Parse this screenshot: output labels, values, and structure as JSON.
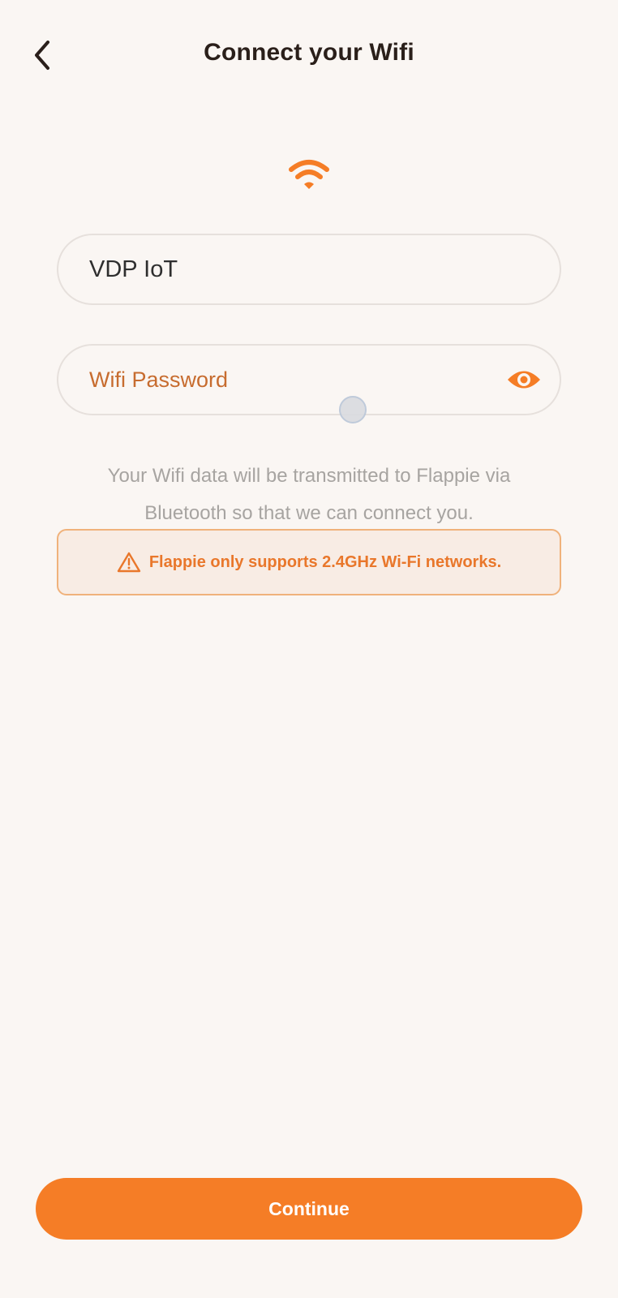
{
  "header": {
    "title": "Connect your Wifi",
    "back_icon": "chevron-left-icon"
  },
  "hero_icon": "wifi-icon",
  "form": {
    "ssid_value": "VDP IoT",
    "password_placeholder": "Wifi Password",
    "password_visibility_icon": "eye-icon"
  },
  "info": {
    "line1": "Your Wifi data will be transmitted to Flappie via",
    "line2": "Bluetooth so that we can connect you."
  },
  "warning": {
    "icon": "warning-triangle-icon",
    "text": "Flappie only supports 2.4GHz Wi-Fi networks."
  },
  "continue_label": "Continue",
  "colors": {
    "accent": "#f57d26",
    "background": "#faf6f3",
    "title": "#2a1f1a",
    "placeholder": "#c76c2f",
    "warning_bg": "#f8ece4",
    "warning_border": "#f0b27b"
  }
}
